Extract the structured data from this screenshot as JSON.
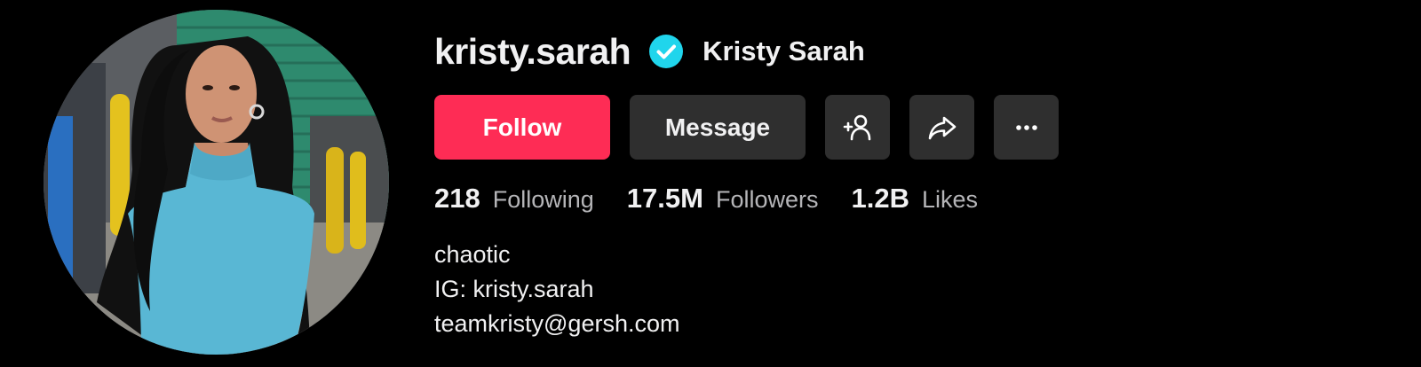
{
  "profile": {
    "username": "kristy.sarah",
    "display_name": "Kristy Sarah",
    "verified": true
  },
  "actions": {
    "follow_label": "Follow",
    "message_label": "Message",
    "icons": [
      "add-friend-icon",
      "share-icon",
      "more-icon"
    ]
  },
  "stats": [
    {
      "value": "218",
      "label": "Following"
    },
    {
      "value": "17.5M",
      "label": "Followers"
    },
    {
      "value": "1.2B",
      "label": "Likes"
    }
  ],
  "bio": {
    "lines": [
      "chaotic",
      "IG: kristy.sarah",
      "teamkristy@gersh.com"
    ]
  },
  "colors": {
    "background": "#000000",
    "follow_button": "#fe2c55",
    "secondary_button": "#2f2f2f",
    "verified_badge": "#20d5ec",
    "muted_text": "#b5b5b8"
  }
}
